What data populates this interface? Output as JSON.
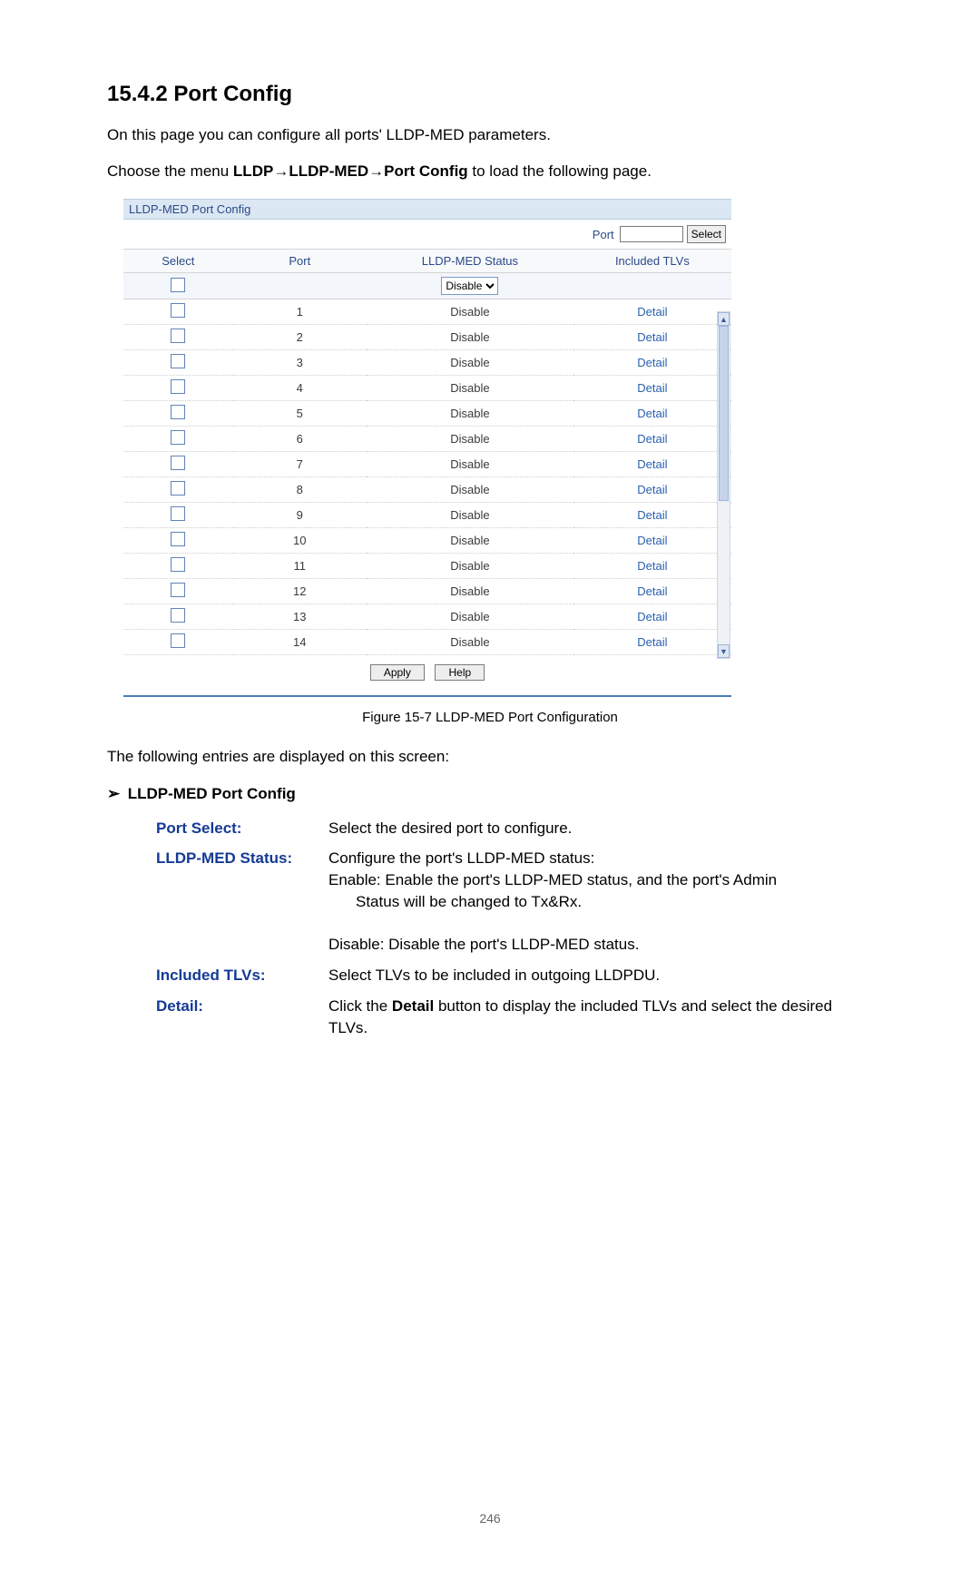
{
  "section_heading": "15.4.2  Port Config",
  "intro_line": "On this page you can configure all ports' LLDP-MED parameters.",
  "breadcrumb_pre": "Choose the menu ",
  "breadcrumb_path_1": "LLDP",
  "breadcrumb_arrow": "→",
  "breadcrumb_path_2": "LLDP-MED",
  "breadcrumb_path_3": "Port Config",
  "breadcrumb_post": " to load the following page.",
  "panel": {
    "title": "LLDP-MED Port Config",
    "port_label": "Port",
    "port_input_value": "",
    "select_btn": "Select",
    "cols": {
      "select": "Select",
      "port": "Port",
      "status": "LLDP-MED Status",
      "tlvs": "Included TLVs"
    },
    "status_dropdown_value": "Disable",
    "rows": [
      {
        "port": "1",
        "status": "Disable",
        "detail": "Detail"
      },
      {
        "port": "2",
        "status": "Disable",
        "detail": "Detail"
      },
      {
        "port": "3",
        "status": "Disable",
        "detail": "Detail"
      },
      {
        "port": "4",
        "status": "Disable",
        "detail": "Detail"
      },
      {
        "port": "5",
        "status": "Disable",
        "detail": "Detail"
      },
      {
        "port": "6",
        "status": "Disable",
        "detail": "Detail"
      },
      {
        "port": "7",
        "status": "Disable",
        "detail": "Detail"
      },
      {
        "port": "8",
        "status": "Disable",
        "detail": "Detail"
      },
      {
        "port": "9",
        "status": "Disable",
        "detail": "Detail"
      },
      {
        "port": "10",
        "status": "Disable",
        "detail": "Detail"
      },
      {
        "port": "11",
        "status": "Disable",
        "detail": "Detail"
      },
      {
        "port": "12",
        "status": "Disable",
        "detail": "Detail"
      },
      {
        "port": "13",
        "status": "Disable",
        "detail": "Detail"
      },
      {
        "port": "14",
        "status": "Disable",
        "detail": "Detail"
      }
    ],
    "apply_btn": "Apply",
    "help_btn": "Help"
  },
  "figure_caption": "Figure 15-7 LLDP-MED Port Configuration",
  "entries_intro": "The following entries are displayed on this screen:",
  "config_subhead": "LLDP-MED Port Config",
  "defs": {
    "port_select": {
      "label": "Port Select:",
      "desc": "Select the desired port to configure."
    },
    "status": {
      "label": "LLDP-MED Status:",
      "line1": "Configure the port's LLDP-MED status:",
      "line2": "Enable: Enable the port's LLDP-MED status, and the port's Admin Status will be changed to Tx&Rx.",
      "line3": "Disable: Disable the port's LLDP-MED status."
    },
    "tlvs": {
      "label": "Included TLVs:",
      "desc": "Select TLVs to be included in outgoing LLDPDU."
    },
    "detail": {
      "label": "Detail:",
      "desc_pre": "Click the ",
      "desc_bold": "Detail",
      "desc_post": " button to display the included TLVs and select the desired TLVs."
    }
  },
  "page_number": "246"
}
